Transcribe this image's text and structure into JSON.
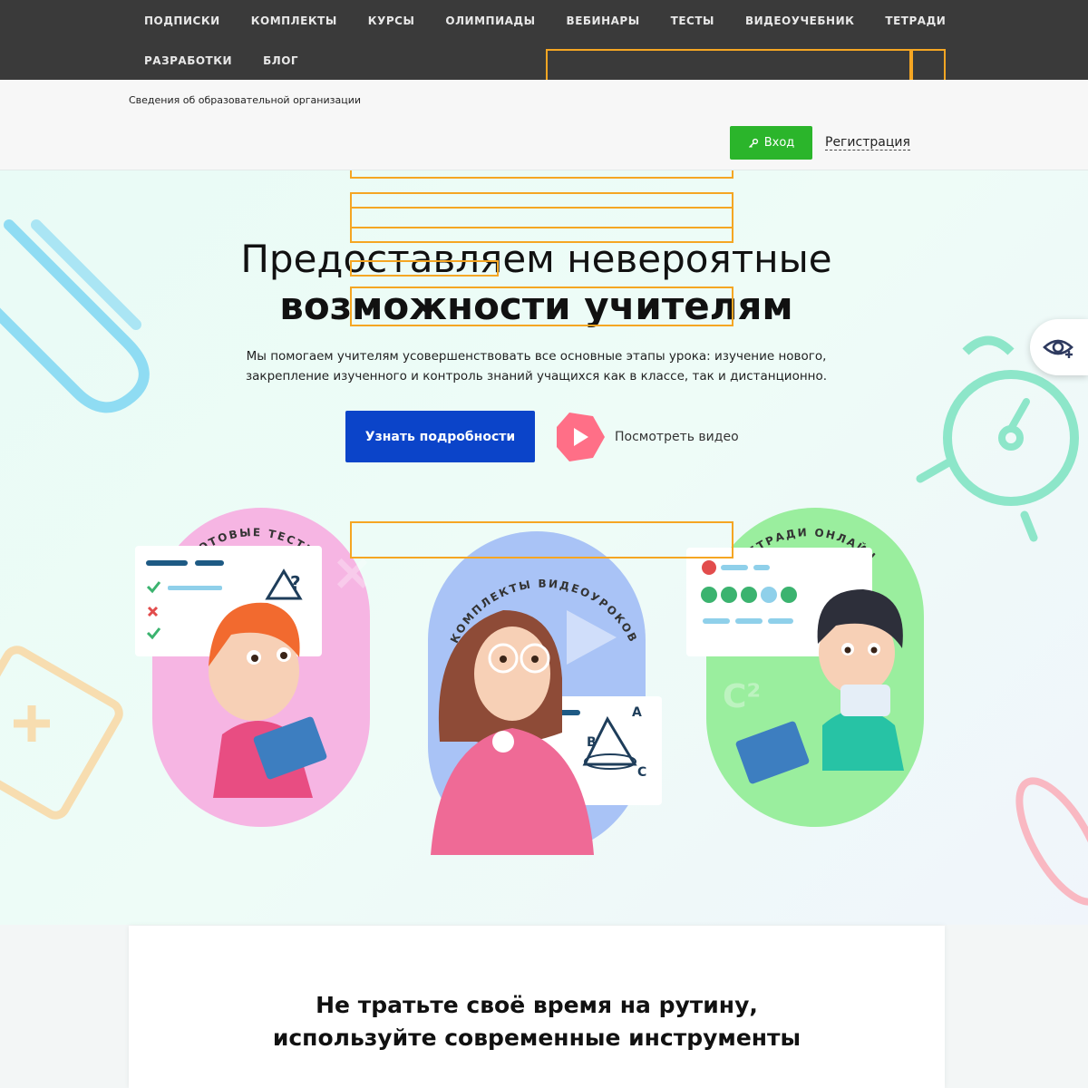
{
  "nav": {
    "row1": [
      "ПОДПИСКИ",
      "КОМПЛЕКТЫ",
      "КУРСЫ",
      "ОЛИМПИАДЫ",
      "ВЕБИНАРЫ",
      "ТЕСТЫ",
      "ВИДЕОУЧЕБНИК",
      "ТЕТРАДИ"
    ],
    "row2": [
      "РАЗРАБОТКИ",
      "БЛОГ"
    ]
  },
  "header": {
    "org_info": "Сведения об образовательной организации",
    "login_label": "Вход",
    "register_label": "Регистрация"
  },
  "hero": {
    "title_line1": "Предоставляем невероятные",
    "title_line2": "возможности учителям",
    "description": "Мы помогаем учителям усовершенствовать все основные этапы урока: изучение нового, закрепление изученного и контроль знаний учащихся как в классе, так и дистанционно.",
    "more_button": "Узнать подробности",
    "video_link": "Посмотреть видео"
  },
  "cards": [
    {
      "label": "ГОТОВЫЕ ТЕСТЫ"
    },
    {
      "label": "КОМПЛЕКТЫ ВИДЕОУРОКОВ"
    },
    {
      "label": "ТЕТРАДИ ОНЛАЙН"
    }
  ],
  "panel": {
    "title_line1": "Не тратьте своё время на рутину,",
    "title_line2": "используйте современные инструменты"
  },
  "colors": {
    "nav_bg": "#3a3a3a",
    "login_green": "#2bb52b",
    "primary_blue": "#0b44c9",
    "play_pink": "#ff6f87",
    "outline_orange": "#f5a623"
  }
}
